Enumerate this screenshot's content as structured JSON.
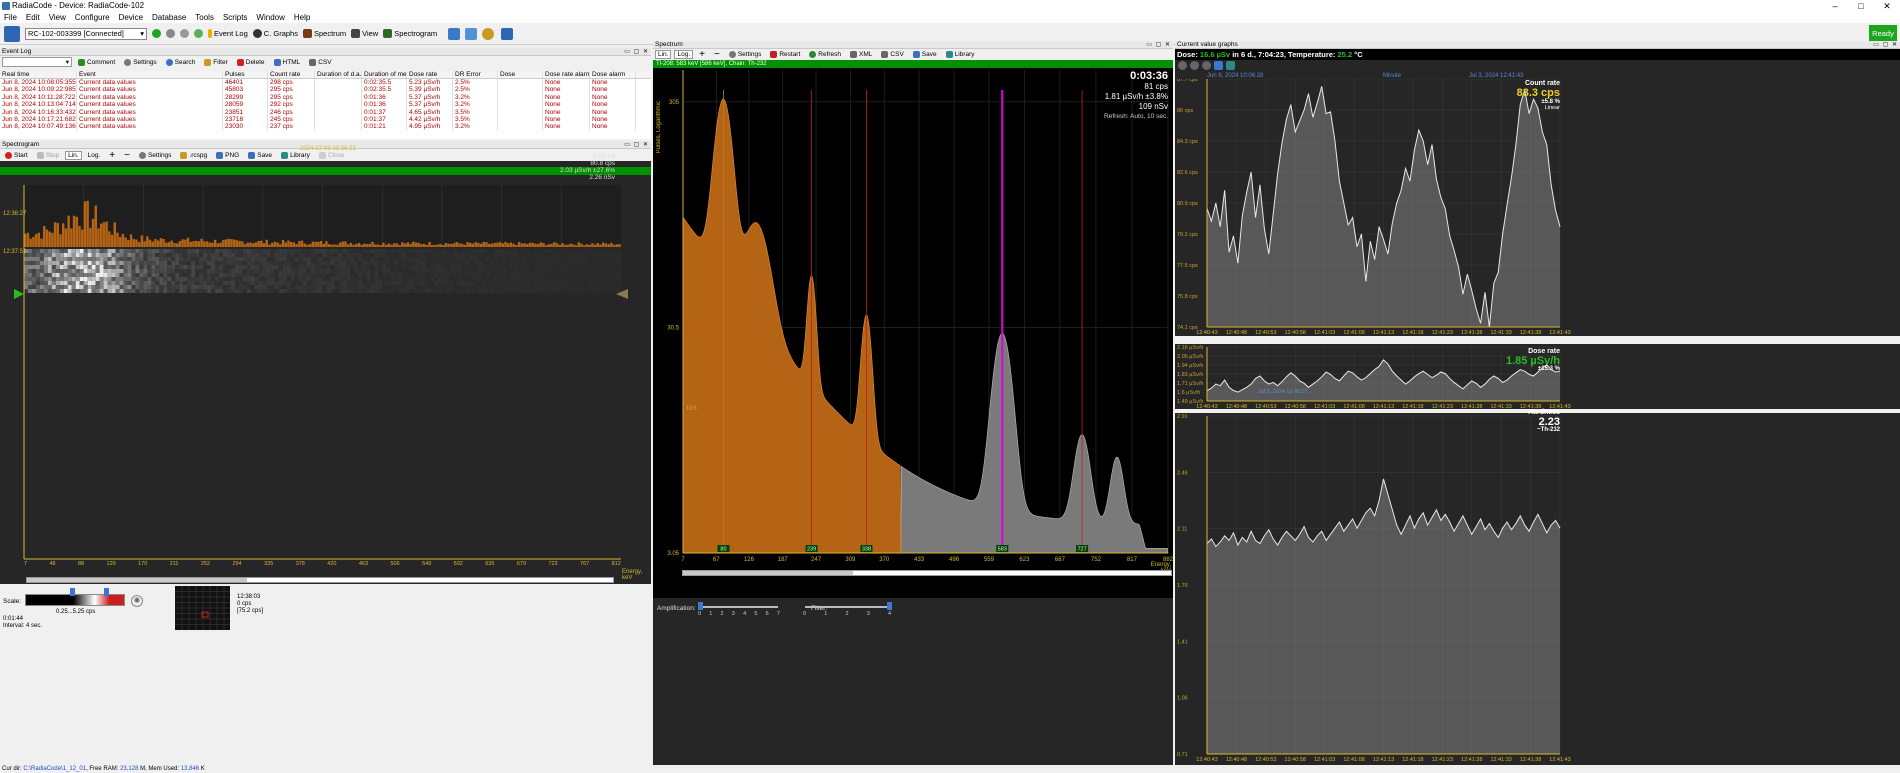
{
  "window": {
    "title": "RadiaCode - Device: RadiaCode-102"
  },
  "menu": [
    "File",
    "Edit",
    "View",
    "Configure",
    "Device",
    "Database",
    "Tools",
    "Scripts",
    "Window",
    "Help"
  ],
  "toolbar": {
    "device_select": "RC-102-003399 [Connected]",
    "event_log": "Event Log",
    "c_graphs": "C. Graphs",
    "spectrum": "Spectrum",
    "view": "View",
    "spectrogram": "Spectrogram",
    "status": "Ready"
  },
  "event_log": {
    "title": "Event Log",
    "buttons": {
      "comment": "Comment",
      "settings": "Settings",
      "search": "Search",
      "filter": "Filter",
      "delete": "Delete",
      "html": "HTML",
      "csv": "CSV"
    },
    "columns": [
      "Real time",
      "Event",
      "Pulses",
      "Count rate",
      "Duration of d.a.",
      "Duration of meas.",
      "Dose rate",
      "DR Error",
      "Dose",
      "Dose rate alarm",
      "Dose alarm"
    ],
    "rows": [
      [
        "Jun 8, 2024  10:08:05:355",
        "Current data values",
        "46401",
        "298 cps",
        "",
        "0:02:35.5",
        "5.23 µSv/h",
        "2.5%",
        "",
        "None",
        "None"
      ],
      [
        "Jun 8, 2024  10:09:22:985",
        "Current data values",
        "45803",
        "295 cps",
        "",
        "0:02:35.5",
        "5.39 µSv/h",
        "2.5%",
        "",
        "None",
        "None"
      ],
      [
        "Jun 8, 2024  10:11:28:722",
        "Current data values",
        "28299",
        "295 cps",
        "",
        "0:01:36",
        "5.37 µSv/h",
        "3.2%",
        "",
        "None",
        "None"
      ],
      [
        "Jun 8, 2024  10:13:04:714",
        "Current data values",
        "28059",
        "292 cps",
        "",
        "0:01:36",
        "5.37 µSv/h",
        "3.2%",
        "",
        "None",
        "None"
      ],
      [
        "Jun 8, 2024  10:16:33:432",
        "Current data values",
        "23851",
        "246 cps",
        "",
        "0:01:37",
        "4.65 µSv/h",
        "3.5%",
        "",
        "None",
        "None"
      ],
      [
        "Jun 8, 2024  10:17:21:682",
        "Current data values",
        "23718",
        "245 cps",
        "",
        "0:01:37",
        "4.42 µSv/h",
        "3.5%",
        "",
        "None",
        "None"
      ],
      [
        "Jun 8, 2024  10:07:49:136",
        "Current data values",
        "23030",
        "237 cps",
        "",
        "0:01:21",
        "4.95 µSv/h",
        "3.2%",
        "",
        "None",
        "None"
      ]
    ]
  },
  "spectrogram": {
    "title": "Spectrogram",
    "buttons": {
      "start": "Start",
      "stop": "Stop",
      "lin": "Lin.",
      "log": "Log.",
      "settings": "Settings",
      "rcspg": ".rcspg",
      "png": "PNG",
      "save": "Save",
      "library": "Library",
      "close": "Close"
    },
    "header_time": "2024-07-03 12:36:23",
    "info": [
      "0:00:04",
      "80.8 cps",
      "2.03 µSv/h ±27.6%",
      "2.26 nSv"
    ],
    "time_top": "12:36:27",
    "time_mid": "12:37:51",
    "energy_ticks": [
      "7",
      "48",
      "88",
      "129",
      "170",
      "211",
      "252",
      "294",
      "335",
      "378",
      "420",
      "463",
      "506",
      "549",
      "592",
      "635",
      "679",
      "723",
      "767",
      "812"
    ],
    "energy_label": "Energy, keV",
    "scale_label": "Scale:",
    "scale_range": "0.25...5.25 cps",
    "footer_left": [
      "0:01:44",
      "Interval: 4 sec."
    ],
    "footer_right": [
      "12:38:03",
      "0 cps",
      "[75.2 cps]"
    ]
  },
  "spectrum": {
    "title": "Spectrum",
    "buttons": {
      "lin": "Lin.",
      "log": "Log.",
      "settings": "Settings",
      "restart": "Restart",
      "refresh": "Refresh",
      "xml": "XML",
      "csv": "CSV",
      "save": "Save",
      "library": "Library"
    },
    "header": "Tl-208: 583 keV [586 keV], Chain: Th-232",
    "y_label": "Pulses, Logarithmic",
    "y_ticks": [
      "305",
      "30.5",
      "3.05"
    ],
    "y_mid": "13.5",
    "info_time": "0:03:36",
    "info_cps": "81 cps",
    "info_dose": "1.81 µSv/h ±3.8%",
    "info_nsv": "109 nSv",
    "info_refresh": "Refresh: Auto, 10 sec.",
    "x_ticks": [
      "7",
      "67",
      "126",
      "187",
      "247",
      "309",
      "370",
      "433",
      "496",
      "559",
      "623",
      "687",
      "752",
      "817",
      "882"
    ],
    "x_label": "Energy, keV",
    "markers": [
      "80",
      "239",
      "338",
      "583",
      "727"
    ],
    "amplification_label": "Amplification:",
    "amplification_ticks": [
      "0",
      "1",
      "2",
      "3",
      "4",
      "5",
      "6",
      "7"
    ],
    "filter_label": "Filter:",
    "filter_ticks": [
      "0",
      "1",
      "2",
      "3",
      "4"
    ],
    "amplification_value": 0,
    "filter_value": 4
  },
  "graphs": {
    "title": "Current value graphs",
    "dose_prefix": "Dose: ",
    "dose_value": "16.6 µSv",
    "dose_mid": " in 6 d., 7:04:23, Temperature: ",
    "temp_value": "25.2",
    "temp_unit": " °C",
    "date_start": "Jun 8, 2024  10:06:28",
    "period": "Minute",
    "date_end": "Jul 3, 2024  12:41:43",
    "count_rate": {
      "title": "Count rate",
      "value": "83.3 cps",
      "error": "±5.8 %",
      "scale": "Linear",
      "y_ticks": [
        "87.7 cps",
        "86 cps",
        "84.3 cps",
        "82.6 cps",
        "80.9 cps",
        "79.2 cps",
        "77.5 cps",
        "75.8 cps",
        "74.1 cps"
      ],
      "values": [
        80.6,
        79.9,
        80.9,
        79.6,
        81.6,
        78.2,
        79.1,
        77.6,
        80.2,
        81.5,
        82.6,
        80.1,
        81.9,
        79.5,
        78.1,
        80.3,
        82.5,
        84.2,
        85.5,
        86.3,
        84.8,
        85.4,
        86.0,
        86.9,
        85.6,
        86.4,
        87.3,
        85.8,
        85.9,
        84.3,
        82.1,
        80.9,
        79.7,
        80.1,
        78.5,
        79.2,
        76.6,
        78.8,
        77.8,
        79.6,
        78.9,
        78.1,
        79.8,
        80.9,
        81.6,
        82.8,
        82.1,
        83.8,
        84.9,
        84.3,
        83.0,
        84.1,
        82.2,
        81.2,
        80.6,
        79.1,
        78.3,
        77.4,
        75.9,
        77.0,
        76.1,
        75.1,
        74.3,
        76.0,
        74.1,
        76.5,
        77.1,
        79.2,
        80.8,
        82.3,
        84.1,
        86.3,
        87.1,
        85.8,
        86.6,
        86.1,
        84.8,
        84.1,
        81.9,
        80.5,
        79.6
      ]
    },
    "dose_rate": {
      "title": "Dose rate",
      "value": "1.85 µSv/h",
      "error": "±15.3 %",
      "y_ticks": [
        "2.16 µSv/h",
        "2.05 µSv/h",
        "1.94 µSv/h",
        "1.83 µSv/h",
        "1.71 µSv/h",
        "1.6 µSv/h",
        "1.49 µSv/h"
      ],
      "marker": "Jul 3, 2024  12:40:57",
      "values": [
        1.62,
        1.65,
        1.7,
        1.68,
        1.75,
        1.66,
        1.62,
        1.6,
        1.63,
        1.66,
        1.7,
        1.77,
        1.8,
        1.74,
        1.7,
        1.72,
        1.68,
        1.73,
        1.79,
        1.84,
        1.8,
        1.74,
        1.71,
        1.66,
        1.7,
        1.74,
        1.79,
        1.85,
        1.82,
        1.77,
        1.74,
        1.8,
        1.86,
        1.84,
        1.79,
        1.75,
        1.78,
        1.83,
        1.88,
        1.92,
        2.0,
        1.95,
        1.86,
        1.8,
        1.75,
        1.7,
        1.74,
        1.79,
        1.83,
        1.86,
        1.82,
        1.78,
        1.81,
        1.85,
        1.83,
        1.77,
        1.72,
        1.68,
        1.64,
        1.69,
        1.74,
        1.71,
        1.66,
        1.7,
        1.76,
        1.8,
        1.77,
        1.72,
        1.75,
        1.8,
        1.84,
        1.88,
        1.86,
        1.82,
        1.8,
        1.85,
        1.9,
        1.94,
        1.88,
        1.85,
        1.86
      ]
    },
    "hardness": {
      "title": "Hardness",
      "value": "2.23",
      "label": "~Th-232",
      "y_ticks": [
        "2.91",
        "2.46",
        "2.11",
        "1.76",
        "1.41",
        "1.06",
        "0.71"
      ],
      "values": [
        2.08,
        2.11,
        2.06,
        2.09,
        2.13,
        2.1,
        2.15,
        2.07,
        2.12,
        2.09,
        2.16,
        2.1,
        2.08,
        2.13,
        2.17,
        2.11,
        2.07,
        2.12,
        2.16,
        2.13,
        2.1,
        2.14,
        2.19,
        2.12,
        2.09,
        2.13,
        2.16,
        2.1,
        2.14,
        2.18,
        2.22,
        2.16,
        2.2,
        2.24,
        2.18,
        2.23,
        2.28,
        2.31,
        2.26,
        2.36,
        2.5,
        2.4,
        2.3,
        2.2,
        2.14,
        2.2,
        2.26,
        2.18,
        2.24,
        2.28,
        2.2,
        2.25,
        2.3,
        2.23,
        2.27,
        2.22,
        2.16,
        2.21,
        2.26,
        2.2,
        2.14,
        2.19,
        2.24,
        2.17,
        2.21,
        2.16,
        2.12,
        2.18,
        2.22,
        2.17,
        2.21,
        2.26,
        2.2,
        2.16,
        2.22,
        2.27,
        2.21,
        2.15,
        2.2,
        2.23,
        2.18
      ]
    },
    "x_ticks": [
      "12:40:43",
      "12:40:48",
      "12:40:53",
      "12:40:58",
      "12:41:03",
      "12:41:08",
      "12:41:13",
      "12:41:18",
      "12:41:23",
      "12:41:28",
      "12:41:33",
      "12:41:38",
      "12:41:43"
    ]
  },
  "status": {
    "prefix": "Cur dir: ",
    "dir": "C:\\RadiaCode\\1_12_01",
    "ram": ", Free RAM: ",
    "ram_val": "23,128",
    "mem": " M, Mem Used: ",
    "mem_val": "13,846",
    "mem_unit": " K"
  },
  "colors": {
    "accent_orange": "#b46414",
    "marker_magenta": "#e000e0",
    "dose_green": "#22c022",
    "count_yellow": "#f0d020",
    "axis_gold": "#d8b830"
  }
}
